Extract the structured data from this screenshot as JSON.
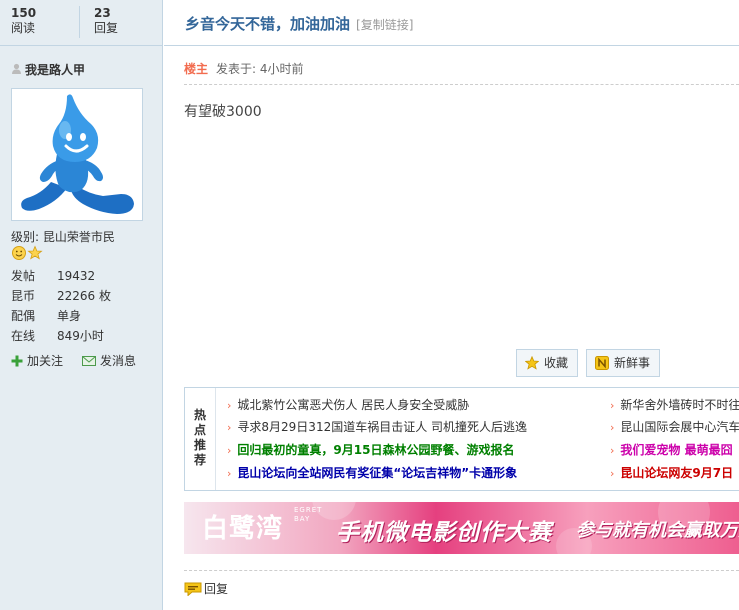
{
  "stats": {
    "views_count": "150",
    "views_label": "阅读",
    "replies_count": "23",
    "replies_label": "回复"
  },
  "thread": {
    "title": "乡音今天不错，加油加油",
    "copy_link": "[复制链接]"
  },
  "author": {
    "name": "我是路人甲",
    "level": "级别: 昆山荣誉市民",
    "fields": [
      {
        "key": "发帖",
        "value": "19432"
      },
      {
        "key": "昆币",
        "value": "22266 枚"
      },
      {
        "key": "配偶",
        "value": "单身"
      },
      {
        "key": "在线",
        "value": "849小时"
      }
    ],
    "follow_label": "加关注",
    "message_label": "发消息"
  },
  "post": {
    "op_badge": "楼主",
    "posted_at": "发表于: 4小时前",
    "content": "有望破3000",
    "favorite_label": "收藏",
    "share_label": "新鲜事",
    "reply_label": "回复"
  },
  "hot": {
    "label_chars": [
      "热",
      "点",
      "推",
      "荐"
    ],
    "left_items": [
      {
        "text": "城北紫竹公寓恶犬伤人 居民人身安全受威胁",
        "color": "#333333",
        "bold": false
      },
      {
        "text": "寻求8月29日312国道车祸目击证人 司机撞死人后逃逸",
        "color": "#333333",
        "bold": false
      },
      {
        "text": "回归最初的童真，9月15日森林公园野餐、游戏报名",
        "color": "#008000",
        "bold": true
      },
      {
        "text": "昆山论坛向全站网民有奖征集“论坛吉祥物”卡通形象",
        "color": "#0000aa",
        "bold": true
      }
    ],
    "right_items": [
      {
        "text": "新华舍外墙砖时不时往下",
        "color": "#333333",
        "bold": false
      },
      {
        "text": "昆山国际会展中心汽车展",
        "color": "#333333",
        "bold": false
      },
      {
        "text": "我们爱宠物 最萌最囧",
        "color": "#cc00aa",
        "bold": true
      },
      {
        "text": "昆山论坛网友9月7日",
        "color": "#cc0000",
        "bold": true
      }
    ]
  },
  "banner": {
    "brand": "白鹭湾",
    "brand_en": "EGRET BAY",
    "headline": "手机微电影创作大赛",
    "tagline": "参与就有机会赢取万元"
  },
  "colors": {
    "sidebar_bg": "#e5edf2",
    "border": "#c2d5e3",
    "title": "#336699",
    "accent": "#f26c4f"
  }
}
